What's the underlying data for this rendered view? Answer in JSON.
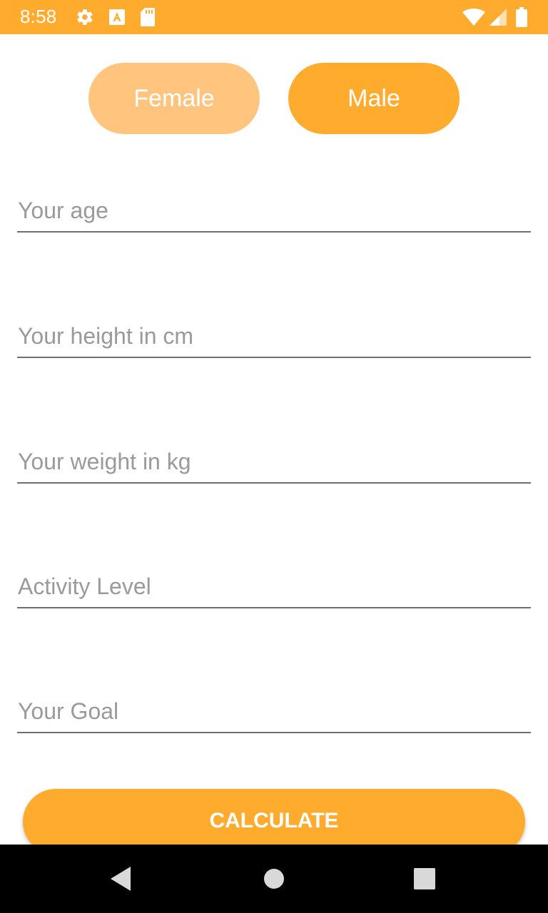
{
  "status_bar": {
    "time": "8:58",
    "background": "#ffab2d",
    "icons": [
      "gear-icon",
      "font-a-icon",
      "sd-card-icon",
      "wifi-icon",
      "signal-icon",
      "battery-icon"
    ]
  },
  "gender": {
    "female_label": "Female",
    "male_label": "Male",
    "selected": "Male",
    "colors": {
      "selected": "#ffab2d",
      "unselected": "#ffc57e"
    }
  },
  "form": {
    "age_placeholder": "Your age",
    "height_placeholder": "Your height in cm",
    "weight_placeholder": "Your weight in kg",
    "activity_placeholder": "Activity Level",
    "goal_placeholder": "Your Goal"
  },
  "calculate_label": "CALCULATE",
  "accent_color": "#ffab2d",
  "nav_bar": {
    "icons": [
      "back-icon",
      "home-icon",
      "recents-icon"
    ]
  }
}
